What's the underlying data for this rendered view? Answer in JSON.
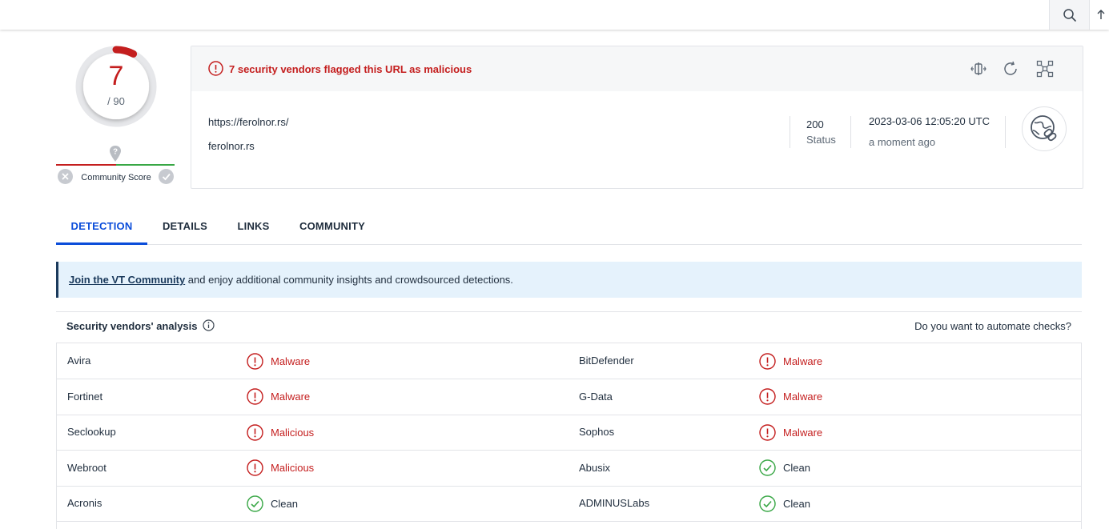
{
  "gauge": {
    "detections": "7",
    "total": "/ 90",
    "fraction": 0.0778,
    "color": "#c41e1e"
  },
  "community": {
    "label": "Community Score"
  },
  "summary": {
    "alert": "7 security vendors flagged this URL as malicious",
    "url": "https://ferolnor.rs/",
    "domain": "ferolnor.rs",
    "status_code": "200",
    "status_label": "Status",
    "date": "2023-03-06 12:05:20 UTC",
    "ago": "a moment ago"
  },
  "tabs": [
    {
      "label": "DETECTION",
      "active": true
    },
    {
      "label": "DETAILS",
      "active": false
    },
    {
      "label": "LINKS",
      "active": false
    },
    {
      "label": "COMMUNITY",
      "active": false
    }
  ],
  "info_banner": {
    "link_text": "Join the VT Community",
    "text": " and enjoy additional community insights and crowdsourced detections."
  },
  "analysis": {
    "title": "Security vendors' analysis",
    "automate": "Do you want to automate checks?",
    "rows": [
      {
        "left": {
          "vendor": "Avira",
          "result": "Malware",
          "bad": true
        },
        "right": {
          "vendor": "BitDefender",
          "result": "Malware",
          "bad": true
        }
      },
      {
        "left": {
          "vendor": "Fortinet",
          "result": "Malware",
          "bad": true
        },
        "right": {
          "vendor": "G-Data",
          "result": "Malware",
          "bad": true
        }
      },
      {
        "left": {
          "vendor": "Seclookup",
          "result": "Malicious",
          "bad": true
        },
        "right": {
          "vendor": "Sophos",
          "result": "Malware",
          "bad": true
        }
      },
      {
        "left": {
          "vendor": "Webroot",
          "result": "Malicious",
          "bad": true
        },
        "right": {
          "vendor": "Abusix",
          "result": "Clean",
          "bad": false
        }
      },
      {
        "left": {
          "vendor": "Acronis",
          "result": "Clean",
          "bad": false
        },
        "right": {
          "vendor": "ADMINUSLabs",
          "result": "Clean",
          "bad": false
        }
      }
    ]
  },
  "colors": {
    "malicious": "#c41e1e",
    "clean": "#38a745",
    "accent": "#0b4dda"
  },
  "icons": {
    "search": "search-icon",
    "upload": "upload-icon",
    "alert": "alert-circle-icon",
    "compare": "compare-icon",
    "reanalyze": "reanalyze-icon",
    "graph": "graph-icon",
    "url_badge": "url-link-globe-icon"
  }
}
